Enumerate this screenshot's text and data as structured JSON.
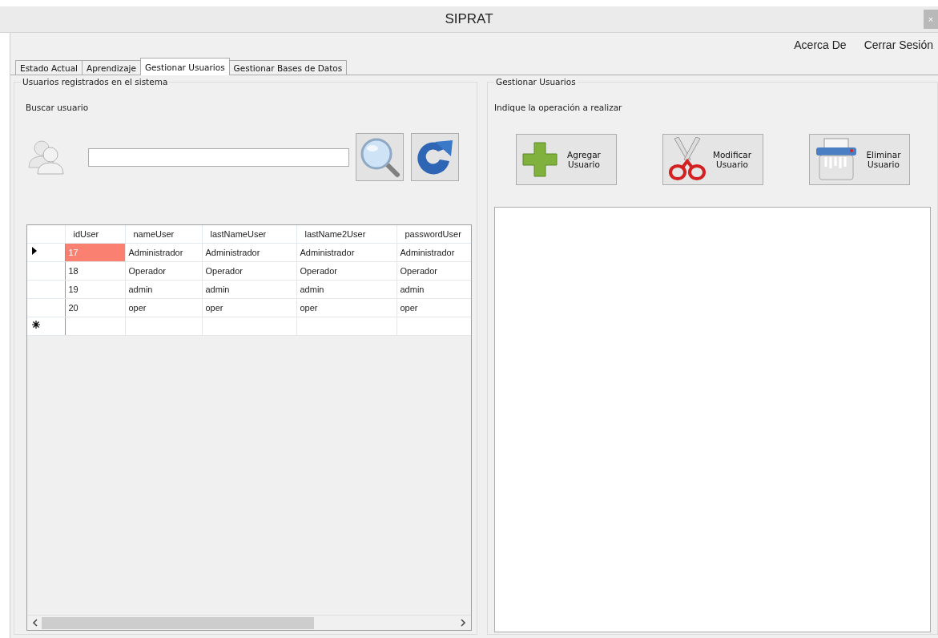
{
  "window": {
    "title": "SIPRAT",
    "close_glyph": "×"
  },
  "menu": [
    "Acerca De",
    "Cerrar Sesión"
  ],
  "tabs": [
    {
      "label": "Estado Actual",
      "selected": false
    },
    {
      "label": "Aprendizaje",
      "selected": false
    },
    {
      "label": "Gestionar Usuarios",
      "selected": true
    },
    {
      "label": "Gestionar Bases de Datos",
      "selected": false
    }
  ],
  "users_group": {
    "title": "Usuarios registrados en el sistema",
    "search_label": "Buscar usuario",
    "grid": {
      "columns": [
        "idUser",
        "nameUser",
        "lastNameUser",
        "lastName2User",
        "passwordUser"
      ],
      "rows": [
        {
          "selected": true,
          "cells": [
            "17",
            "Administrador",
            "Administrador",
            "Administrador",
            "Administrador"
          ]
        },
        {
          "selected": false,
          "cells": [
            "18",
            "Operador",
            "Operador",
            "Operador",
            "Operador"
          ]
        },
        {
          "selected": false,
          "cells": [
            "19",
            "admin",
            "admin",
            "admin",
            "admin"
          ]
        },
        {
          "selected": false,
          "cells": [
            "20",
            "oper",
            "oper",
            "oper",
            "oper"
          ]
        }
      ]
    }
  },
  "manage_group": {
    "title": "Gestionar Usuarios",
    "instruction": "Indique la operación a realizar",
    "actions": [
      {
        "kind": "add",
        "label": "Agregar Usuario"
      },
      {
        "kind": "edit",
        "label": "Modificar Usuario"
      },
      {
        "kind": "delete",
        "label": "Eliminar Usuario"
      }
    ]
  }
}
